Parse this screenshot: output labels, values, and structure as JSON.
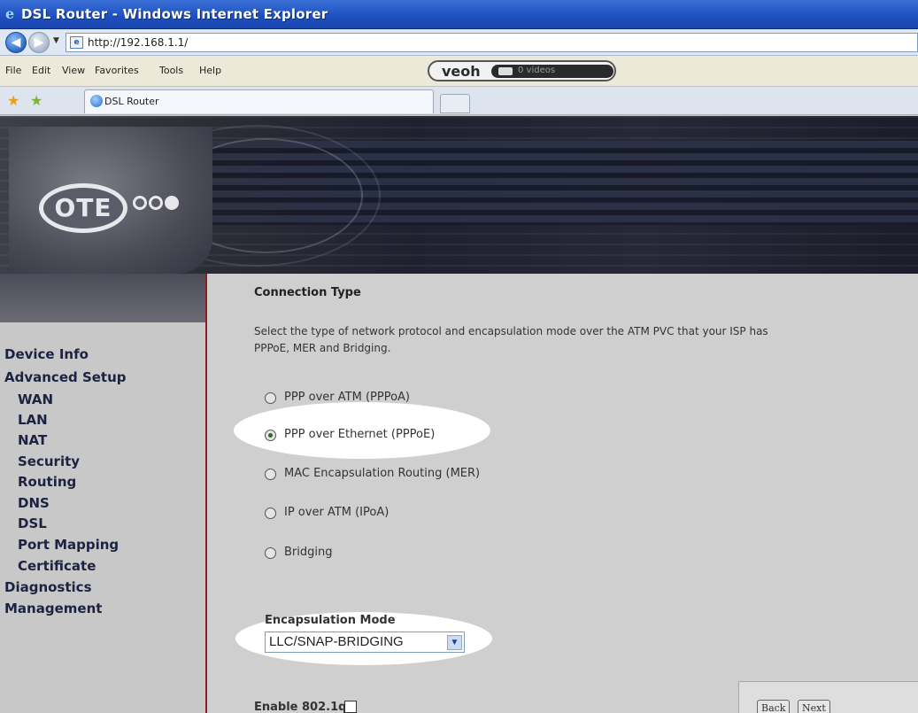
{
  "window": {
    "title": "DSL Router - Windows Internet Explorer"
  },
  "address": {
    "url": "http://192.168.1.1/"
  },
  "menu": {
    "items": [
      "File",
      "Edit",
      "View",
      "Favorites",
      "Tools",
      "Help"
    ]
  },
  "toolbar": {
    "veoh_logo": "veoh",
    "veoh_videos": "0 videos"
  },
  "tabs": {
    "active_label": "DSL Router"
  },
  "nav": {
    "items": [
      "Device Info",
      "Advanced Setup",
      "WAN",
      "LAN",
      "NAT",
      "Security",
      "Routing",
      "DNS",
      "DSL",
      "Port Mapping",
      "Certificate",
      "Diagnostics",
      "Management"
    ]
  },
  "main": {
    "title": "Connection Type",
    "description_line1": "Select the type of network protocol and encapsulation mode over the ATM PVC that your ISP has",
    "description_line2": "PPPoE, MER and Bridging.",
    "options": [
      {
        "label": "PPP over ATM (PPPoA)",
        "checked": false
      },
      {
        "label": "PPP over Ethernet (PPPoE)",
        "checked": true
      },
      {
        "label": "MAC Encapsulation Routing (MER)",
        "checked": false
      },
      {
        "label": "IP over ATM (IPoA)",
        "checked": false
      },
      {
        "label": "Bridging",
        "checked": false
      }
    ],
    "encapsulation_title": "Encapsulation Mode",
    "encapsulation_value": "LLC/SNAP-BRIDGING",
    "enable_8021q_label": "Enable 802.1q",
    "back_label": "Back",
    "next_label": "Next"
  },
  "brand": {
    "logo_text": "OTE"
  }
}
